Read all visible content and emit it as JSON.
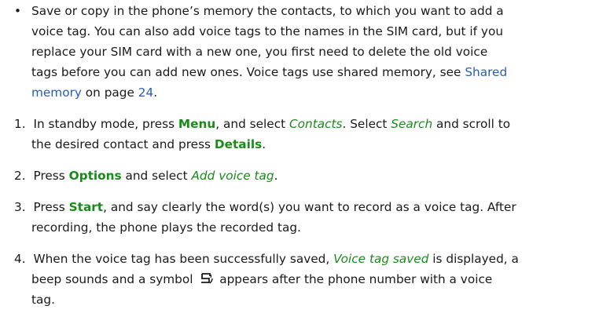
{
  "bullet": {
    "glyph": "•",
    "l1": "Save or copy in the phone’s memory the contacts, to which you want to add a",
    "l2": "voice tag. You can also add voice tags to the names in the SIM card, but if you",
    "l3": "replace your SIM card with a new one, you first need to delete the old voice",
    "l4a": "tags before you can add new ones. Voice tags use shared memory, see ",
    "l4link": "Shared",
    "l5link": "memory",
    "l5b": " on page ",
    "l5page": "24",
    "l5end": "."
  },
  "step1": {
    "num": "1.",
    "a": "In standby mode, press ",
    "menu": "Menu",
    "b": ", and select ",
    "contacts": "Contacts",
    "c": ". Select ",
    "search": "Search",
    "d": " and scroll to",
    "e": "the desired contact and press ",
    "details": "Details",
    "f": "."
  },
  "step2": {
    "num": "2.",
    "a": "Press ",
    "options": "Options",
    "b": " and select ",
    "addtag": "Add voice tag",
    "c": "."
  },
  "step3": {
    "num": "3.",
    "a": "Press ",
    "start": "Start",
    "b": ", and say clearly the word(s) you want to record as a voice tag. After",
    "c": "recording, the phone plays the recorded tag."
  },
  "step4": {
    "num": "4.",
    "a": "When the voice tag has been successfully saved, ",
    "saved": "Voice tag saved",
    "b": " is displayed, a",
    "c": "beep sounds and a symbol ",
    "d": " appears after the phone number with a voice",
    "e": "tag."
  },
  "colors": {
    "green": "#1a8a1a",
    "link": "#2a5db0",
    "text": "#1a1a1a"
  },
  "icons": {
    "voice_tag_symbol": "voice-tag-icon"
  }
}
